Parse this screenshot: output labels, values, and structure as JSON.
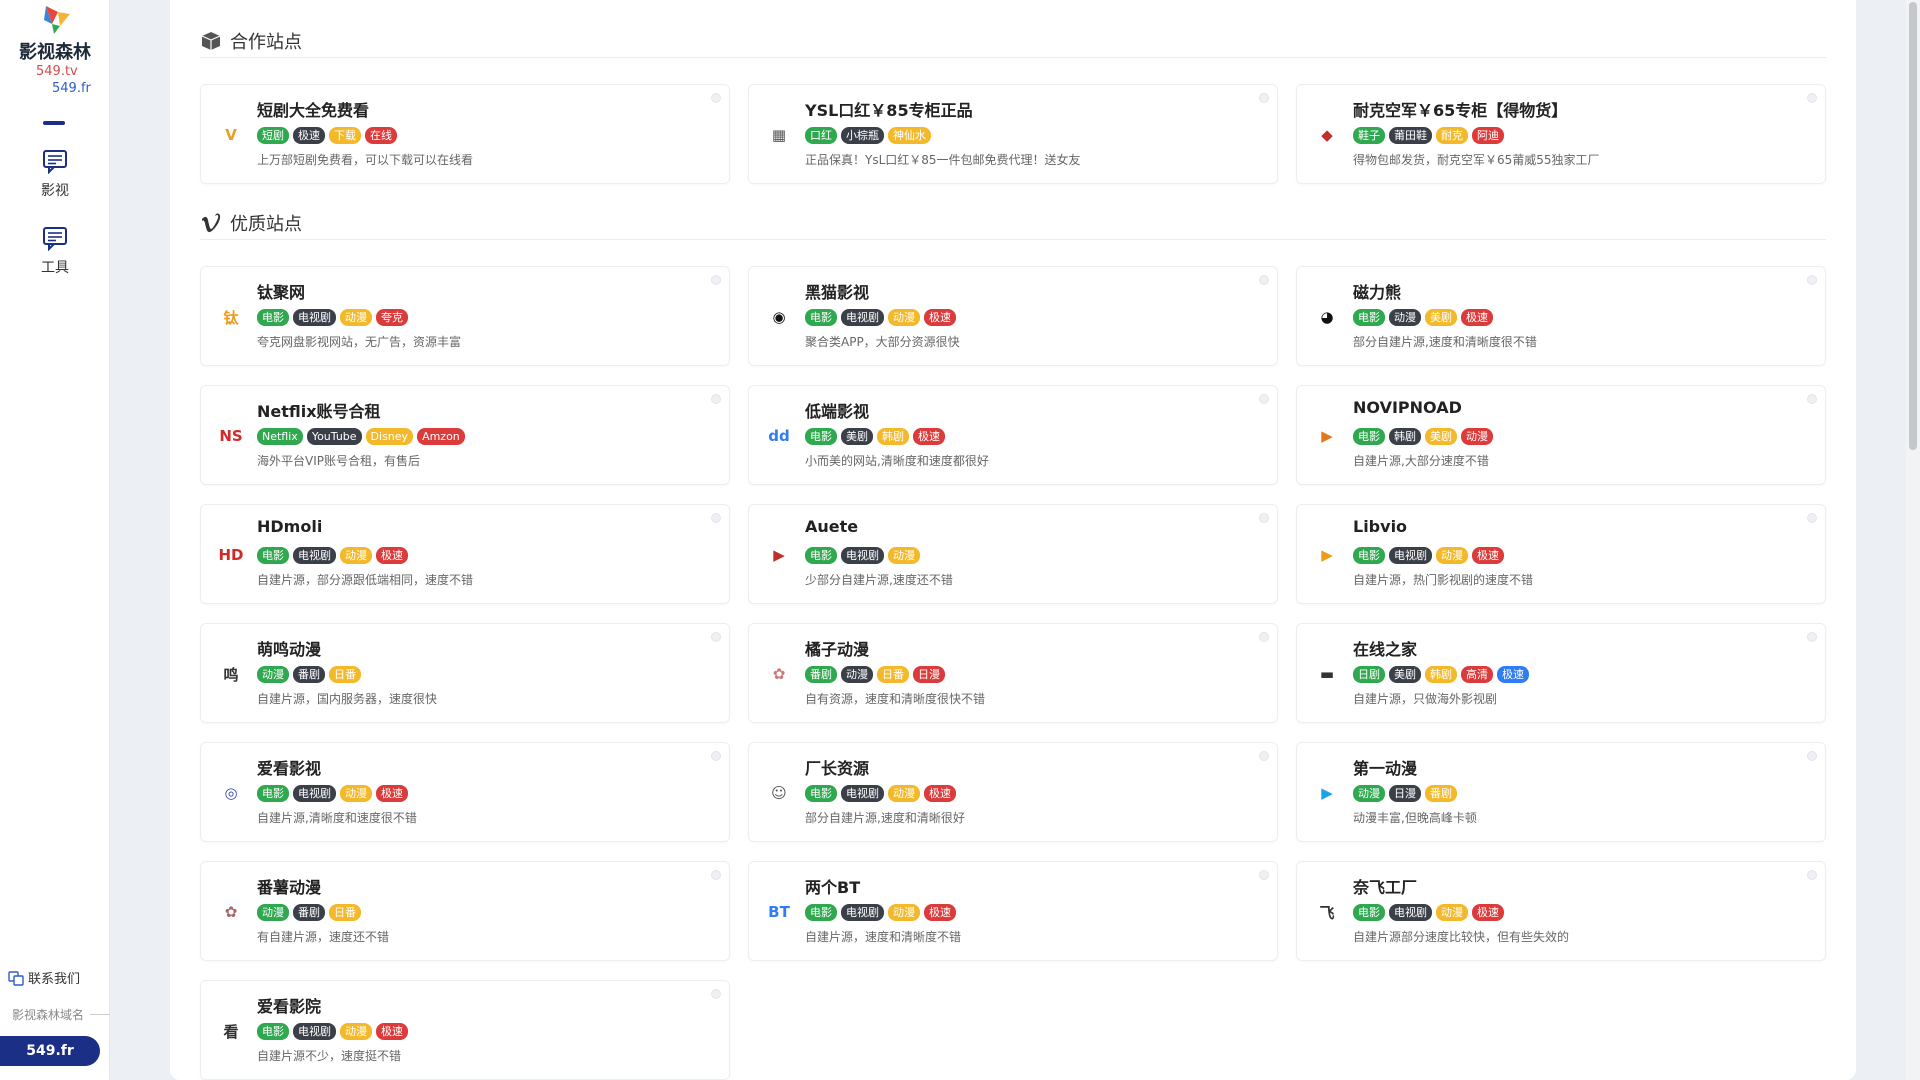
{
  "sidebar": {
    "logo_text": "影视森林",
    "domain1": "549.tv",
    "domain2": "549.fr",
    "nav": [
      {
        "label": "影视",
        "icon": "chat-icon"
      },
      {
        "label": "工具",
        "icon": "chat-icon"
      }
    ],
    "contact": "联系我们",
    "domain_label": "影视森林域名",
    "domain_pill": "549.fr"
  },
  "colors": {
    "brand": "#1c2f87",
    "green": "#2fa84f",
    "dark": "#3a3f48",
    "yellow": "#f3b92a",
    "red": "#dc3b3b",
    "blue": "#2f7df6"
  },
  "sections": [
    {
      "title": "合作站点",
      "icon": "box-icon",
      "cards": [
        {
          "title": "短剧大全免费看",
          "icon_text": "V",
          "icon_color": "#e8a020",
          "tags": [
            [
              "短剧",
              "green"
            ],
            [
              "极速",
              "dark"
            ],
            [
              "下载",
              "yellow"
            ],
            [
              "在线",
              "red"
            ]
          ],
          "desc": "上万部短剧免费看，可以下载可以在线看"
        },
        {
          "title": "YSL口红￥85专柜正品",
          "icon_text": "▦",
          "icon_color": "#555",
          "tags": [
            [
              "口红",
              "green"
            ],
            [
              "小棕瓶",
              "dark"
            ],
            [
              "神仙水",
              "yellow"
            ]
          ],
          "desc": "正品保真！YsL口红￥85一件包邮免费代理！送女友"
        },
        {
          "title": "耐克空军￥65专柜【得物货】",
          "icon_text": "◆",
          "icon_color": "#c0302a",
          "tags": [
            [
              "鞋子",
              "green"
            ],
            [
              "莆田鞋",
              "dark"
            ],
            [
              "耐克",
              "yellow"
            ],
            [
              "阿迪",
              "red"
            ]
          ],
          "desc": "得物包邮发货，耐克空军￥65莆威55独家工厂"
        }
      ]
    },
    {
      "title": "优质站点",
      "icon": "vimeo-icon",
      "cards": [
        {
          "title": "钛聚网",
          "icon_text": "钛",
          "icon_color": "#f09a1a",
          "tags": [
            [
              "电影",
              "green"
            ],
            [
              "电视剧",
              "dark"
            ],
            [
              "动漫",
              "yellow"
            ],
            [
              "夸克",
              "red"
            ]
          ],
          "desc": "夸克网盘影视网站，无广告，资源丰富"
        },
        {
          "title": "黑猫影视",
          "icon_text": "◉",
          "icon_color": "#111",
          "tags": [
            [
              "电影",
              "green"
            ],
            [
              "电视剧",
              "dark"
            ],
            [
              "动漫",
              "yellow"
            ],
            [
              "极速",
              "red"
            ]
          ],
          "desc": "聚合类APP，大部分资源很快"
        },
        {
          "title": "磁力熊",
          "icon_text": "◕",
          "icon_color": "#111",
          "tags": [
            [
              "电影",
              "green"
            ],
            [
              "动漫",
              "dark"
            ],
            [
              "美剧",
              "yellow"
            ],
            [
              "极速",
              "red"
            ]
          ],
          "desc": "部分自建片源,速度和清晰度很不错"
        },
        {
          "title": "Netflix账号合租",
          "icon_text": "NS",
          "icon_color": "#d12a2a",
          "tags": [
            [
              "Netflix",
              "green"
            ],
            [
              "YouTube",
              "dark"
            ],
            [
              "Disney",
              "yellow"
            ],
            [
              "Amzon",
              "red"
            ]
          ],
          "desc": "海外平台VIP账号合租，有售后"
        },
        {
          "title": "低端影视",
          "icon_text": "dd",
          "icon_color": "#2f7df6",
          "tags": [
            [
              "电影",
              "green"
            ],
            [
              "美剧",
              "dark"
            ],
            [
              "韩剧",
              "yellow"
            ],
            [
              "极速",
              "red"
            ]
          ],
          "desc": "小而美的网站,清晰度和速度都很好"
        },
        {
          "title": "NOVIPNOAD",
          "icon_text": "▶",
          "icon_color": "#e07a1a",
          "tags": [
            [
              "电影",
              "green"
            ],
            [
              "韩剧",
              "dark"
            ],
            [
              "美剧",
              "yellow"
            ],
            [
              "动漫",
              "red"
            ]
          ],
          "desc": "自建片源,大部分速度不错"
        },
        {
          "title": "HDmoli",
          "icon_text": "HD",
          "icon_color": "#d12a2a",
          "tags": [
            [
              "电影",
              "green"
            ],
            [
              "电视剧",
              "dark"
            ],
            [
              "动漫",
              "yellow"
            ],
            [
              "极速",
              "red"
            ]
          ],
          "desc": "自建片源，部分源跟低端相同，速度不错"
        },
        {
          "title": "Auete",
          "icon_text": "▶",
          "icon_color": "#c0302a",
          "tags": [
            [
              "电影",
              "green"
            ],
            [
              "电视剧",
              "dark"
            ],
            [
              "动漫",
              "yellow"
            ]
          ],
          "desc": "少部分自建片源,速度还不错"
        },
        {
          "title": "Libvio",
          "icon_text": "▶",
          "icon_color": "#f09a1a",
          "tags": [
            [
              "电影",
              "green"
            ],
            [
              "电视剧",
              "dark"
            ],
            [
              "动漫",
              "yellow"
            ],
            [
              "极速",
              "red"
            ]
          ],
          "desc": "自建片源，热门影视剧的速度不错"
        },
        {
          "title": "萌鸣动漫",
          "icon_text": "鸣",
          "icon_color": "#333",
          "tags": [
            [
              "动漫",
              "green"
            ],
            [
              "番剧",
              "dark"
            ],
            [
              "日番",
              "yellow"
            ]
          ],
          "desc": "自建片源，国内服务器，速度很快"
        },
        {
          "title": "橘子动漫",
          "icon_text": "✿",
          "icon_color": "#c77",
          "tags": [
            [
              "番剧",
              "green"
            ],
            [
              "动漫",
              "dark"
            ],
            [
              "日番",
              "yellow"
            ],
            [
              "日漫",
              "red"
            ]
          ],
          "desc": "自有资源，速度和清晰度很快不错"
        },
        {
          "title": "在线之家",
          "icon_text": "▬",
          "icon_color": "#333",
          "tags": [
            [
              "日剧",
              "green"
            ],
            [
              "美剧",
              "dark"
            ],
            [
              "韩剧",
              "yellow"
            ],
            [
              "高清",
              "red"
            ],
            [
              "极速",
              "blue"
            ]
          ],
          "desc": "自建片源，只做海外影视剧"
        },
        {
          "title": "爱看影视",
          "icon_text": "◎",
          "icon_color": "#3b4bb5",
          "tags": [
            [
              "电影",
              "green"
            ],
            [
              "电视剧",
              "dark"
            ],
            [
              "动漫",
              "yellow"
            ],
            [
              "极速",
              "red"
            ]
          ],
          "desc": "自建片源,清晰度和速度很不错"
        },
        {
          "title": "厂长资源",
          "icon_text": "☺",
          "icon_color": "#555",
          "tags": [
            [
              "电影",
              "green"
            ],
            [
              "电视剧",
              "dark"
            ],
            [
              "动漫",
              "yellow"
            ],
            [
              "极速",
              "red"
            ]
          ],
          "desc": "部分自建片源,速度和清晰很好"
        },
        {
          "title": "第一动漫",
          "icon_text": "▶",
          "icon_color": "#1aa3e8",
          "tags": [
            [
              "动漫",
              "green"
            ],
            [
              "日漫",
              "dark"
            ],
            [
              "番剧",
              "yellow"
            ]
          ],
          "desc": "动漫丰富,但晚高峰卡顿"
        },
        {
          "title": "番薯动漫",
          "icon_text": "✿",
          "icon_color": "#a66",
          "tags": [
            [
              "动漫",
              "green"
            ],
            [
              "番剧",
              "dark"
            ],
            [
              "日番",
              "yellow"
            ]
          ],
          "desc": "有自建片源，速度还不错"
        },
        {
          "title": "两个BT",
          "icon_text": "BT",
          "icon_color": "#2f7df6",
          "tags": [
            [
              "电影",
              "green"
            ],
            [
              "电视剧",
              "dark"
            ],
            [
              "动漫",
              "yellow"
            ],
            [
              "极速",
              "red"
            ]
          ],
          "desc": "自建片源，速度和清晰度不错"
        },
        {
          "title": "奈飞工厂",
          "icon_text": "飞",
          "icon_color": "#333",
          "tags": [
            [
              "电影",
              "green"
            ],
            [
              "电视剧",
              "dark"
            ],
            [
              "动漫",
              "yellow"
            ],
            [
              "极速",
              "red"
            ]
          ],
          "desc": "自建片源部分速度比较快，但有些失效的"
        },
        {
          "title": "爱看影院",
          "icon_text": "看",
          "icon_color": "#333",
          "tags": [
            [
              "电影",
              "green"
            ],
            [
              "电视剧",
              "dark"
            ],
            [
              "动漫",
              "yellow"
            ],
            [
              "极速",
              "red"
            ]
          ],
          "desc": "自建片源不少，速度挺不错"
        }
      ]
    }
  ]
}
